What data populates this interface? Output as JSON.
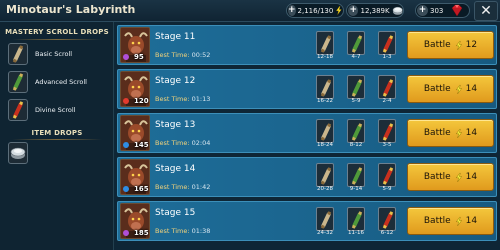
{
  "header": {
    "title": "Minotaur's Labyrinth",
    "resources": [
      {
        "name": "energy",
        "value": "2,116/130",
        "icon": "energy-bolt-icon"
      },
      {
        "name": "silver",
        "value": "12,389K",
        "icon": "silver-coin-icon"
      },
      {
        "name": "gems",
        "value": "303",
        "icon": "gem-icon"
      }
    ],
    "close_label": "✕"
  },
  "left_panel": {
    "mastery_title": "MASTERY SCROLL DROPS",
    "scrolls": [
      {
        "label": "Basic Scroll",
        "icon": "basic-scroll-icon"
      },
      {
        "label": "Advanced Scroll",
        "icon": "advanced-scroll-icon"
      },
      {
        "label": "Divine Scroll",
        "icon": "divine-scroll-icon"
      }
    ],
    "items_title": "ITEM DROPS",
    "items": [
      {
        "icon": "silver-coin-icon"
      }
    ]
  },
  "stages": [
    {
      "name": "Stage 11",
      "best_time_label": "Best Time:",
      "best_time": "00:52",
      "level": "95",
      "affinity_color": "#b04fd8",
      "rewards": [
        "12-18",
        "4-7",
        "1-3"
      ],
      "battle_label": "Battle",
      "energy_cost": "12"
    },
    {
      "name": "Stage 12",
      "best_time_label": "Best Time:",
      "best_time": "01:13",
      "level": "120",
      "affinity_color": "#e23b2e",
      "rewards": [
        "16-22",
        "5-9",
        "2-4"
      ],
      "battle_label": "Battle",
      "energy_cost": "14"
    },
    {
      "name": "Stage 13",
      "best_time_label": "Best Time:",
      "best_time": "02:04",
      "level": "145",
      "affinity_color": "#2f8de4",
      "rewards": [
        "18-24",
        "8-12",
        "3-5"
      ],
      "battle_label": "Battle",
      "energy_cost": "14"
    },
    {
      "name": "Stage 14",
      "best_time_label": "Best Time:",
      "best_time": "01:42",
      "level": "165",
      "affinity_color": "#2f8de4",
      "rewards": [
        "20-28",
        "9-14",
        "5-9"
      ],
      "battle_label": "Battle",
      "energy_cost": "14"
    },
    {
      "name": "Stage 15",
      "best_time_label": "Best Time:",
      "best_time": "01:38",
      "level": "185",
      "affinity_color": "#b04fd8",
      "rewards": [
        "24-32",
        "11-16",
        "6-12"
      ],
      "battle_label": "Battle",
      "energy_cost": "14"
    }
  ],
  "colors": {
    "row_blue": "#1e6d98",
    "battle_gold": "#f4c73c",
    "header_bg": "#102433"
  }
}
